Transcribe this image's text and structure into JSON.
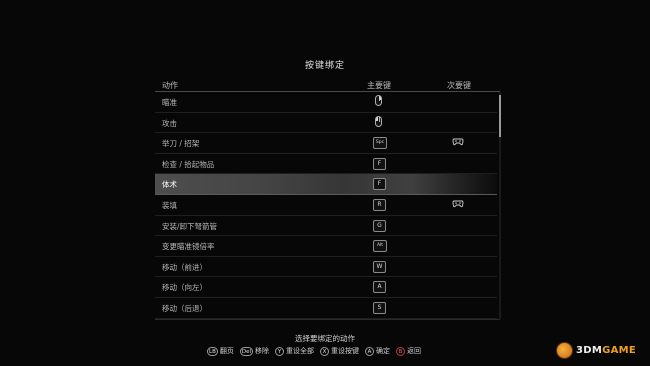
{
  "title": "按键绑定",
  "columns": {
    "action": "动作",
    "primary": "主要键",
    "secondary": "次要键"
  },
  "rows": [
    {
      "label": "瞄准",
      "primary_icon": "mouse-right-icon",
      "primary": "",
      "secondary_icon": ""
    },
    {
      "label": "攻击",
      "primary_icon": "mouse-left-icon",
      "primary": "",
      "secondary_icon": ""
    },
    {
      "label": "举刀 / 招架",
      "primary_icon": "",
      "primary": "Spc",
      "secondary_icon": "controller-icon"
    },
    {
      "label": "检查 / 拾起物品",
      "primary_icon": "",
      "primary": "F",
      "secondary_icon": ""
    },
    {
      "label": "体术",
      "primary_icon": "",
      "primary": "F",
      "secondary_icon": "",
      "selected": true
    },
    {
      "label": "装填",
      "primary_icon": "",
      "primary": "R",
      "secondary_icon": "controller-icon"
    },
    {
      "label": "安装/卸下弩箭管",
      "primary_icon": "",
      "primary": "G",
      "secondary_icon": ""
    },
    {
      "label": "变更瞄准镜倍率",
      "primary_icon": "",
      "primary": "Alt",
      "secondary_icon": ""
    },
    {
      "label": "移动（前进）",
      "primary_icon": "",
      "primary": "W",
      "secondary_icon": ""
    },
    {
      "label": "移动（向左）",
      "primary_icon": "",
      "primary": "A",
      "secondary_icon": ""
    },
    {
      "label": "移动（后退）",
      "primary_icon": "",
      "primary": "S",
      "secondary_icon": ""
    }
  ],
  "prompt": "选择要绑定的动作",
  "footer": [
    {
      "glyph": "LB",
      "label": "翻页"
    },
    {
      "glyph": "Del",
      "label": "移除"
    },
    {
      "glyph": "Y",
      "label": "重设全部"
    },
    {
      "glyph": "X",
      "label": "重设按键"
    },
    {
      "glyph": "A",
      "label": "确定"
    },
    {
      "glyph": "B",
      "label": "返回",
      "color": "#c23a3a"
    }
  ],
  "watermark": {
    "brand": "3DM",
    "suffix": "GAME"
  }
}
